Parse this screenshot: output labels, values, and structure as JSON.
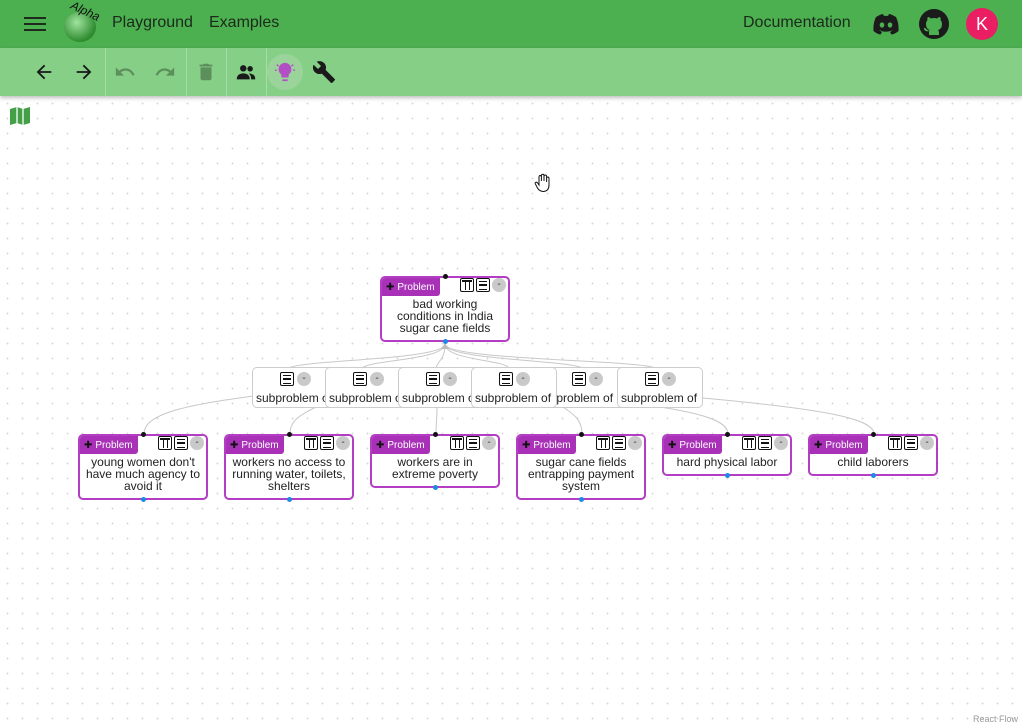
{
  "appbar": {
    "links": {
      "playground": "Playground",
      "examples": "Examples",
      "documentation": "Documentation"
    },
    "logo_text": "Alpha",
    "avatar_initial": "K",
    "colors": {
      "appbar": "#4caf50",
      "toolbar": "#86cf86",
      "avatar": "#e91e63"
    },
    "icons": [
      "menu-icon",
      "discord-icon",
      "github-icon"
    ]
  },
  "toolbar": {
    "icons": [
      "back-arrow-icon",
      "forward-arrow-icon",
      "undo-icon",
      "redo-icon",
      "trash-icon",
      "people-icon",
      "lightbulb-icon",
      "wrench-icon"
    ]
  },
  "canvas": {
    "attribution": "React Flow",
    "root": {
      "type": "Problem",
      "text": "bad working conditions in India sugar cane fields"
    },
    "subproblems": [
      {
        "text": "subproblem of"
      },
      {
        "text": "subproblem of"
      },
      {
        "text": "subproblem of"
      },
      {
        "text": "subproblem of"
      },
      {
        "text": "subproblem of"
      },
      {
        "text": "subproblem of"
      }
    ],
    "children": [
      {
        "type": "Problem",
        "text": "young women don't have much agency to avoid it"
      },
      {
        "type": "Problem",
        "text": "workers no access to running water, toilets, shelters"
      },
      {
        "type": "Problem",
        "text": "workers are in extreme poverty"
      },
      {
        "type": "Problem",
        "text": "sugar cane fields entrapping payment system"
      },
      {
        "type": "Problem",
        "text": "hard physical labor"
      },
      {
        "type": "Problem",
        "text": "child laborers"
      }
    ],
    "colors": {
      "problem_border": "#b33ec4",
      "problem_badge": "#a831b8",
      "handle_top": "#111111",
      "handle_bottom": "#1e88e5"
    }
  }
}
